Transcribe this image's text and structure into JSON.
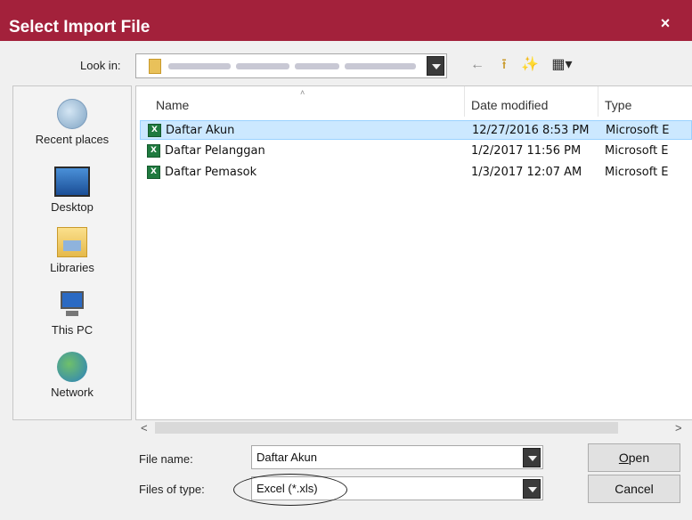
{
  "dialog": {
    "title": "Select Import File",
    "close_glyph": "×"
  },
  "toolbar": {
    "look_in_label": "Look in:",
    "back_glyph": "←",
    "up_folder_glyph": "⭱",
    "new_folder_glyph": "✨",
    "view_glyph": "▦▾"
  },
  "places": [
    {
      "label": "Recent places",
      "icon": "recent-places-icon"
    },
    {
      "label": "Desktop",
      "icon": "desktop-icon"
    },
    {
      "label": "Libraries",
      "icon": "libraries-icon"
    },
    {
      "label": "This PC",
      "icon": "this-pc-icon"
    },
    {
      "label": "Network",
      "icon": "network-icon"
    }
  ],
  "file_list": {
    "columns": [
      "Name",
      "Date modified",
      "Type"
    ],
    "sort_glyph": "˄",
    "rows": [
      {
        "name": "Daftar Akun",
        "date": "12/27/2016 8:53 PM",
        "type": "Microsoft E",
        "selected": true
      },
      {
        "name": "Daftar Pelanggan",
        "date": "1/2/2017 11:56 PM",
        "type": "Microsoft E",
        "selected": false
      },
      {
        "name": "Daftar Pemasok",
        "date": "1/3/2017 12:07 AM",
        "type": "Microsoft E",
        "selected": false
      }
    ],
    "xl_glyph": "X"
  },
  "scroll": {
    "left_glyph": "<",
    "right_glyph": ">"
  },
  "form": {
    "file_name_label": "File name:",
    "file_name_value": "Daftar Akun",
    "files_of_type_label": "Files of type:",
    "files_of_type_value": "Excel (*.xls)"
  },
  "buttons": {
    "open_mnemonic": "O",
    "open_rest": "pen",
    "cancel": "Cancel"
  },
  "colors": {
    "titlebar": "#a3213b",
    "selection": "#cce8ff",
    "excel_green": "#1f7a3f"
  }
}
